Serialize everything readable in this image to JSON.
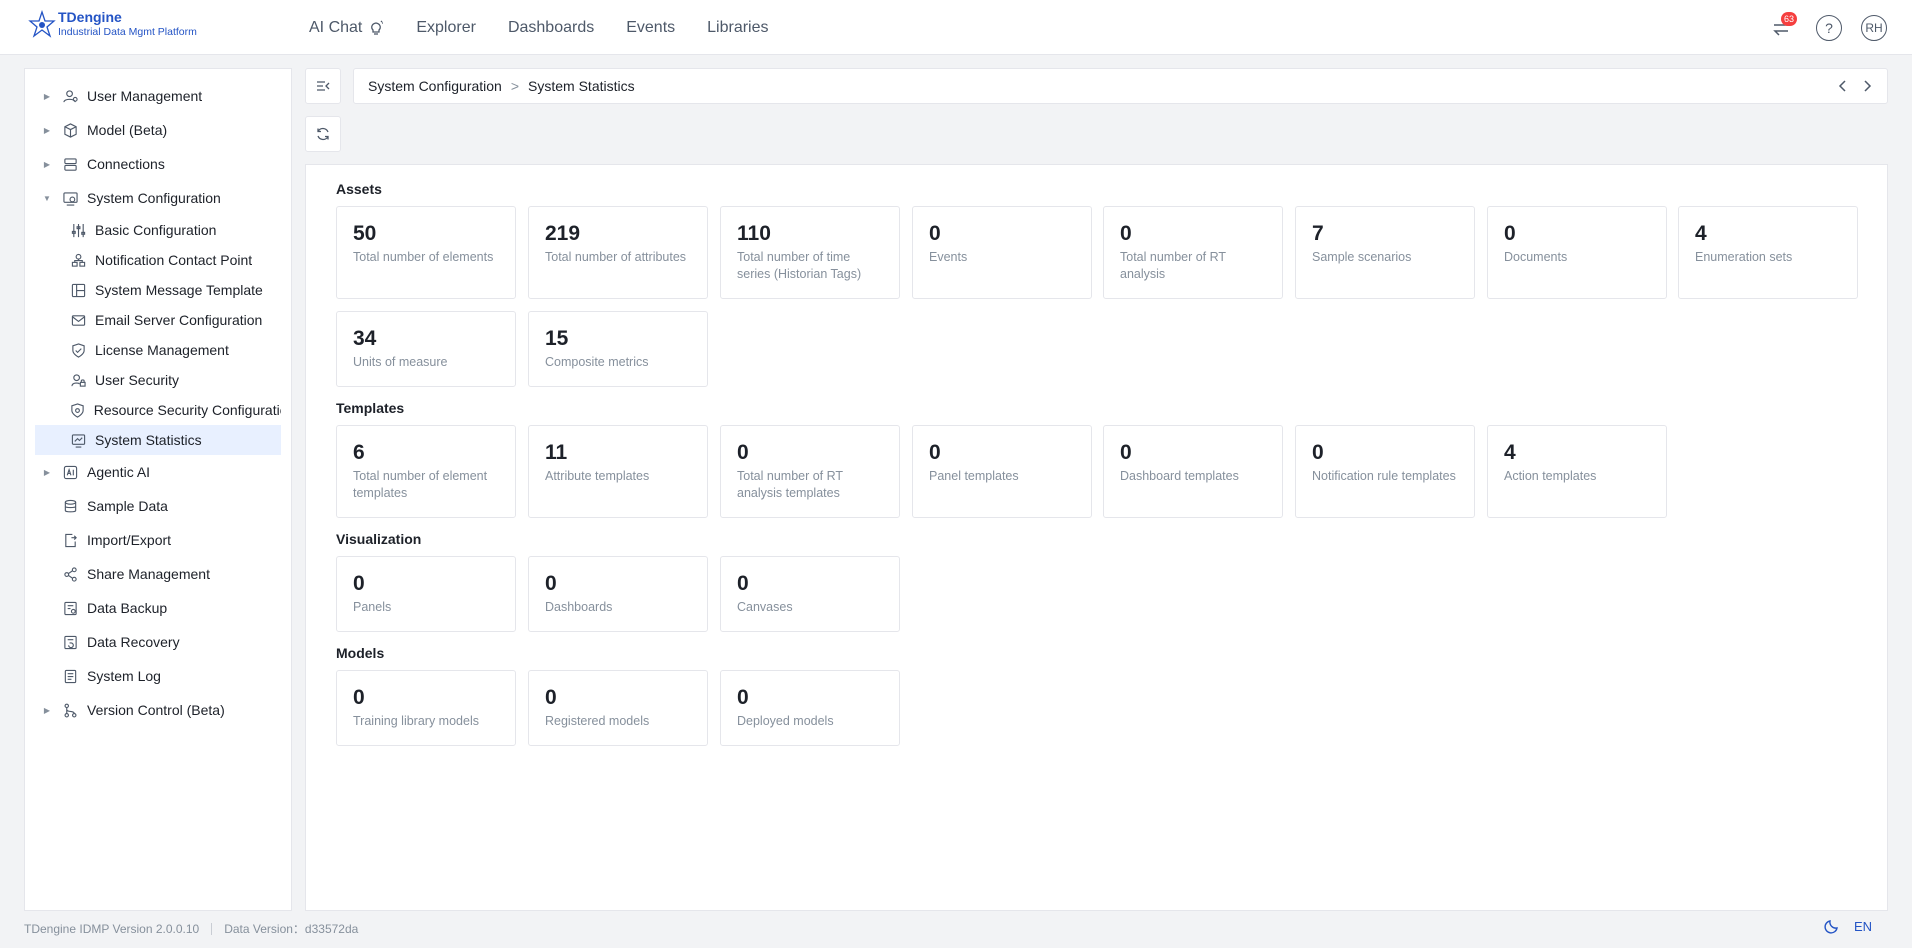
{
  "app": {
    "name": "TDengine",
    "subtitle": "Industrial Data Mgmt Platform"
  },
  "nav": [
    {
      "label": "AI Chat",
      "icon": "sparkle-bulb-icon"
    },
    {
      "label": "Explorer"
    },
    {
      "label": "Dashboards"
    },
    {
      "label": "Events"
    },
    {
      "label": "Libraries"
    }
  ],
  "header": {
    "notification_count": "63",
    "help_label": "?",
    "avatar_initials": "RH"
  },
  "sidebar": {
    "items": [
      {
        "label": "User Management",
        "icon": "users-icon",
        "expandable": true
      },
      {
        "label": "Model (Beta)",
        "icon": "cube-icon",
        "expandable": true
      },
      {
        "label": "Connections",
        "icon": "connections-icon",
        "expandable": true
      },
      {
        "label": "System Configuration",
        "icon": "system-config-icon",
        "expandable": true,
        "expanded": true
      },
      {
        "label": "Basic Configuration",
        "icon": "sliders-icon",
        "sub": true
      },
      {
        "label": "Notification Contact Point",
        "icon": "contact-point-icon",
        "sub": true
      },
      {
        "label": "System Message Template",
        "icon": "template-icon",
        "sub": true
      },
      {
        "label": "Email Server Configuration",
        "icon": "mail-icon",
        "sub": true
      },
      {
        "label": "License Management",
        "icon": "shield-check-icon",
        "sub": true
      },
      {
        "label": "User Security",
        "icon": "user-lock-icon",
        "sub": true
      },
      {
        "label": "Resource Security Configuration",
        "icon": "shield-gear-icon",
        "sub": true
      },
      {
        "label": "System Statistics",
        "icon": "statistics-icon",
        "sub": true,
        "active": true
      },
      {
        "label": "Agentic AI",
        "icon": "ai-icon",
        "expandable": true
      },
      {
        "label": "Sample Data",
        "icon": "database-icon"
      },
      {
        "label": "Import/Export",
        "icon": "import-export-icon"
      },
      {
        "label": "Share Management",
        "icon": "share-icon"
      },
      {
        "label": "Data Backup",
        "icon": "backup-icon"
      },
      {
        "label": "Data Recovery",
        "icon": "recovery-icon"
      },
      {
        "label": "System Log",
        "icon": "log-icon"
      },
      {
        "label": "Version Control (Beta)",
        "icon": "git-branch-icon",
        "expandable": true
      }
    ]
  },
  "breadcrumb": {
    "parent": "System Configuration",
    "current": "System Statistics"
  },
  "sections": [
    {
      "title": "Assets",
      "cards": [
        {
          "value": "50",
          "label": "Total number of elements"
        },
        {
          "value": "219",
          "label": "Total number of attributes"
        },
        {
          "value": "110",
          "label": "Total number of time series (Historian Tags)"
        },
        {
          "value": "0",
          "label": "Events"
        },
        {
          "value": "0",
          "label": "Total number of RT analysis"
        },
        {
          "value": "7",
          "label": "Sample scenarios"
        },
        {
          "value": "0",
          "label": "Documents"
        },
        {
          "value": "4",
          "label": "Enumeration sets"
        },
        {
          "value": "34",
          "label": "Units of measure"
        },
        {
          "value": "15",
          "label": "Composite metrics"
        }
      ]
    },
    {
      "title": "Templates",
      "cards": [
        {
          "value": "6",
          "label": "Total number of element templates"
        },
        {
          "value": "11",
          "label": "Attribute templates"
        },
        {
          "value": "0",
          "label": "Total number of RT analysis templates"
        },
        {
          "value": "0",
          "label": "Panel templates"
        },
        {
          "value": "0",
          "label": "Dashboard templates"
        },
        {
          "value": "0",
          "label": "Notification rule templates"
        },
        {
          "value": "4",
          "label": "Action templates"
        }
      ]
    },
    {
      "title": "Visualization",
      "cards": [
        {
          "value": "0",
          "label": "Panels"
        },
        {
          "value": "0",
          "label": "Dashboards"
        },
        {
          "value": "0",
          "label": "Canvases"
        }
      ]
    },
    {
      "title": "Models",
      "cards": [
        {
          "value": "0",
          "label": "Training library models"
        },
        {
          "value": "0",
          "label": "Registered models"
        },
        {
          "value": "0",
          "label": "Deployed models"
        }
      ]
    }
  ],
  "footer": {
    "app_version": "TDengine IDMP Version 2.0.0.10",
    "data_version": "Data Version：d33572da",
    "language": "EN"
  },
  "colors": {
    "brand": "#2454c5",
    "active_bg": "#e8f0ff",
    "badge": "#f53f3f"
  }
}
